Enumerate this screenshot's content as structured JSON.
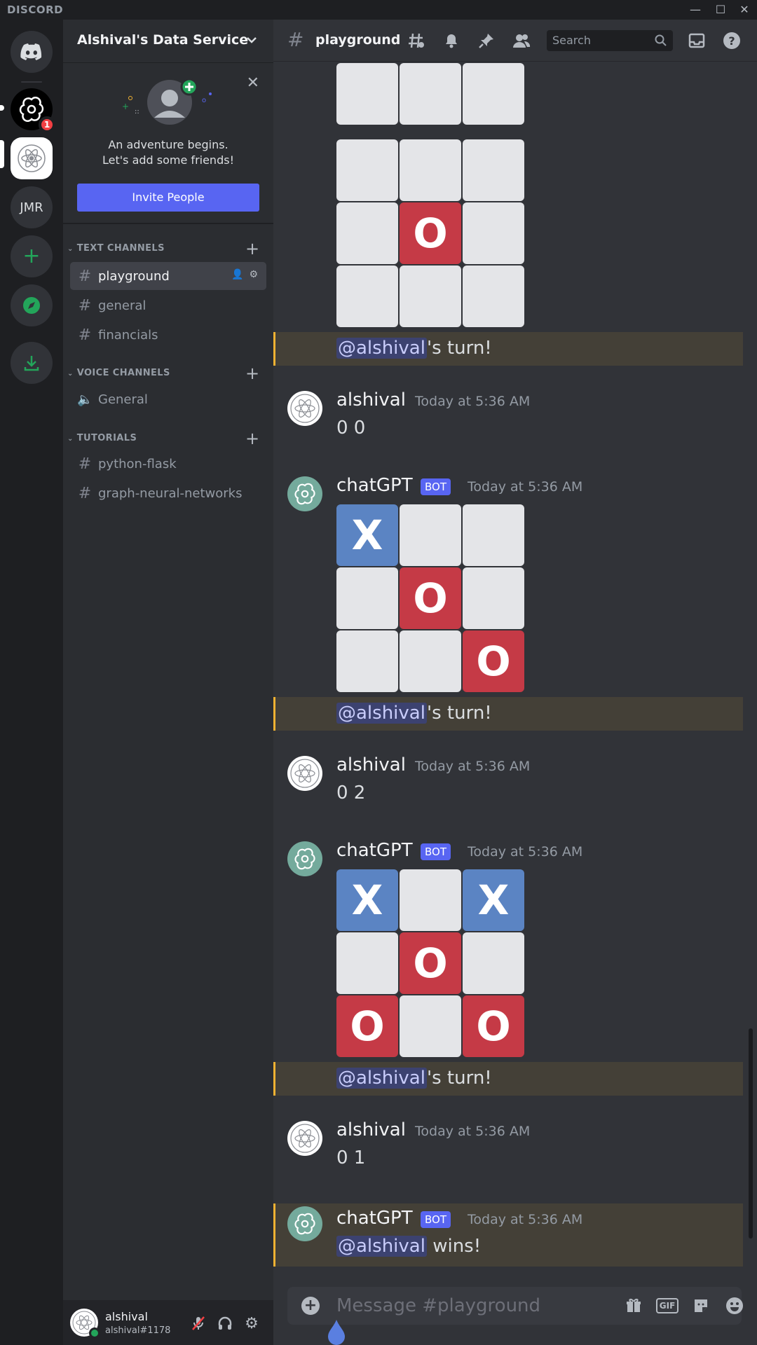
{
  "window": {
    "brand": "DISCORD",
    "controls": [
      "—",
      "☐",
      "✕"
    ]
  },
  "rail": {
    "servers": [
      {
        "name": "home",
        "icon": "discord-logo-icon"
      },
      {
        "name": "chatgpt-server",
        "icon": "openai-logo-icon",
        "badge": "1"
      },
      {
        "name": "alshival-data-service",
        "icon": "atom-logo-icon",
        "selected": true
      },
      {
        "name": "jmr",
        "label": "JMR"
      }
    ],
    "actions": [
      "add-server-icon",
      "explore-icon",
      "download-icon"
    ]
  },
  "sidebar": {
    "guild_name": "Alshival's Data Service",
    "invite": {
      "line1": "An adventure begins.",
      "line2": "Let's add some friends!",
      "button": "Invite People"
    },
    "categories": [
      {
        "label": "TEXT CHANNELS",
        "channels": [
          {
            "name": "playground",
            "type": "text",
            "active": true
          },
          {
            "name": "general",
            "type": "text"
          },
          {
            "name": "financials",
            "type": "text-locked"
          }
        ]
      },
      {
        "label": "VOICE CHANNELS",
        "channels": [
          {
            "name": "General",
            "type": "voice"
          }
        ]
      },
      {
        "label": "TUTORIALS",
        "channels": [
          {
            "name": "python-flask",
            "type": "text"
          },
          {
            "name": "graph-neural-networks",
            "type": "text"
          }
        ]
      }
    ],
    "user": {
      "name": "alshival",
      "tag": "alshival#1178",
      "status": "online"
    }
  },
  "header": {
    "channel": "playground",
    "search_placeholder": "Search"
  },
  "messages": {
    "board0": [
      "",
      "",
      "",
      "",
      "O",
      "",
      "",
      "",
      ""
    ],
    "turn1": {
      "mention": "@alshival",
      "rest": "'s turn!"
    },
    "m1": {
      "author": "alshival",
      "time": "Today at 5:36 AM",
      "text": "0 0"
    },
    "m2": {
      "author": "chatGPT",
      "bot": "BOT",
      "time": "Today at 5:36 AM"
    },
    "board2": [
      "X",
      "",
      "",
      "",
      "O",
      "",
      "",
      "",
      "O"
    ],
    "turn2": {
      "mention": "@alshival",
      "rest": "'s turn!"
    },
    "m3": {
      "author": "alshival",
      "time": "Today at 5:36 AM",
      "text": "0 2"
    },
    "m4": {
      "author": "chatGPT",
      "bot": "BOT",
      "time": "Today at 5:36 AM"
    },
    "board4": [
      "X",
      "",
      "X",
      "",
      "O",
      "",
      "O",
      "",
      "O"
    ],
    "turn3": {
      "mention": "@alshival",
      "rest": "'s turn!"
    },
    "m5": {
      "author": "alshival",
      "time": "Today at 5:36 AM",
      "text": "0 1"
    },
    "m6": {
      "author": "chatGPT",
      "bot": "BOT",
      "time": "Today at 5:36 AM",
      "mention": "@alshival",
      "rest": " wins!"
    }
  },
  "composer": {
    "placeholder": "Message #playground",
    "gif_label": "GIF"
  },
  "colors": {
    "accent": "#5865f2",
    "x_cell": "#5b84c3",
    "o_cell": "#c53a46",
    "mention_bg": "#444037",
    "online": "#23a55a"
  }
}
